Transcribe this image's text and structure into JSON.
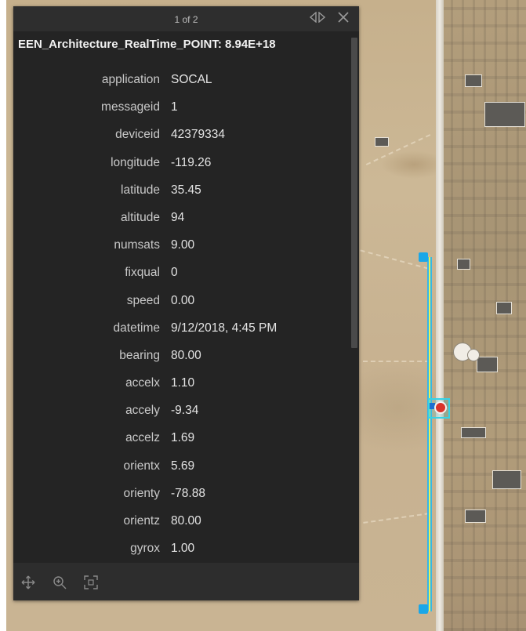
{
  "popup": {
    "pager_text": "1 of 2",
    "title": "EEN_Architecture_RealTime_POINT: 8.94E+18",
    "fields": [
      {
        "label": "application",
        "value": "SOCAL"
      },
      {
        "label": "messageid",
        "value": "1"
      },
      {
        "label": "deviceid",
        "value": "42379334"
      },
      {
        "label": "longitude",
        "value": "-119.26"
      },
      {
        "label": "latitude",
        "value": "35.45"
      },
      {
        "label": "altitude",
        "value": "94"
      },
      {
        "label": "numsats",
        "value": "9.00"
      },
      {
        "label": "fixqual",
        "value": "0"
      },
      {
        "label": "speed",
        "value": "0.00"
      },
      {
        "label": "datetime",
        "value": "9/12/2018, 4:45 PM"
      },
      {
        "label": "bearing",
        "value": "80.00"
      },
      {
        "label": "accelx",
        "value": "1.10"
      },
      {
        "label": "accely",
        "value": "-9.34"
      },
      {
        "label": "accelz",
        "value": "1.69"
      },
      {
        "label": "orientx",
        "value": "5.69"
      },
      {
        "label": "orienty",
        "value": "-78.88"
      },
      {
        "label": "orientz",
        "value": "80.00"
      },
      {
        "label": "gyrox",
        "value": "1.00"
      }
    ],
    "icons": {
      "pager_nav": "dock-toggle-icon",
      "close": "close-icon",
      "pan": "pan-icon",
      "zoom": "zoom-to-icon",
      "fullscreen": "fullscreen-icon"
    }
  },
  "map": {
    "route_color": "#e8f254",
    "route_outline": "#35b7e9",
    "selection_color": "#36d3e6",
    "marker_color": "#d9342b"
  }
}
